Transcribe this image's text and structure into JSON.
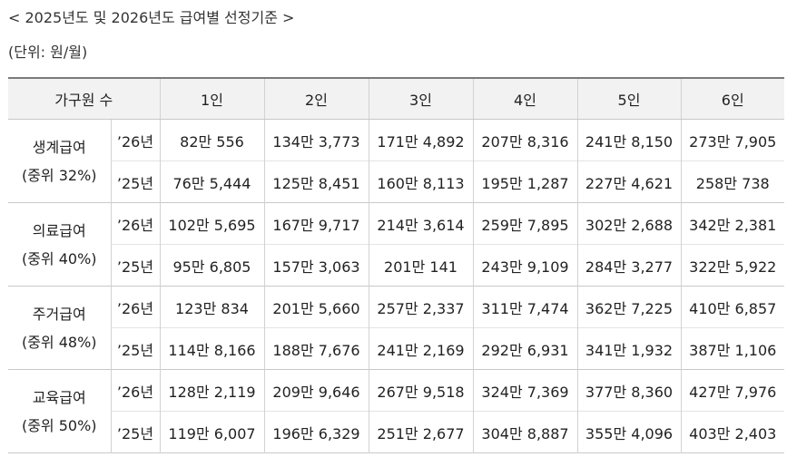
{
  "title": "< 2025년도 및 2026년도 급여별 선정기준 >",
  "unit": "(단위: 원/월)",
  "table": {
    "header": {
      "household": "가구원 수",
      "sizes": [
        "1인",
        "2인",
        "3인",
        "4인",
        "5인",
        "6인"
      ]
    },
    "groups": [
      {
        "name": "생계급여",
        "criterion": "(중위 32%)",
        "rows": [
          {
            "year": "’26년",
            "values": [
              "82만 556",
              "134만 3,773",
              "171만 4,892",
              "207만 8,316",
              "241만 8,150",
              "273만 7,905"
            ]
          },
          {
            "year": "’25년",
            "values": [
              "76만 5,444",
              "125만 8,451",
              "160만 8,113",
              "195만 1,287",
              "227만 4,621",
              "258만 738"
            ]
          }
        ]
      },
      {
        "name": "의료급여",
        "criterion": "(중위 40%)",
        "rows": [
          {
            "year": "’26년",
            "values": [
              "102만 5,695",
              "167만 9,717",
              "214만 3,614",
              "259만 7,895",
              "302만 2,688",
              "342만 2,381"
            ]
          },
          {
            "year": "’25년",
            "values": [
              "95만 6,805",
              "157만 3,063",
              "201만 141",
              "243만 9,109",
              "284만 3,277",
              "322만 5,922"
            ]
          }
        ]
      },
      {
        "name": "주거급여",
        "criterion": "(중위 48%)",
        "rows": [
          {
            "year": "’26년",
            "values": [
              "123만 834",
              "201만 5,660",
              "257만 2,337",
              "311만 7,474",
              "362만 7,225",
              "410만 6,857"
            ]
          },
          {
            "year": "’25년",
            "values": [
              "114만 8,166",
              "188만 7,676",
              "241만 2,169",
              "292만 6,931",
              "341만 1,932",
              "387만 1,106"
            ]
          }
        ]
      },
      {
        "name": "교육급여",
        "criterion": "(중위 50%)",
        "rows": [
          {
            "year": "’26년",
            "values": [
              "128만 2,119",
              "209만 9,646",
              "267만 9,518",
              "324만 7,369",
              "377만 8,360",
              "427만 7,976"
            ]
          },
          {
            "year": "’25년",
            "values": [
              "119만 6,007",
              "196만 6,329",
              "251만 2,677",
              "304만 8,887",
              "355만 4,096",
              "403만 2,403"
            ]
          }
        ]
      }
    ]
  }
}
